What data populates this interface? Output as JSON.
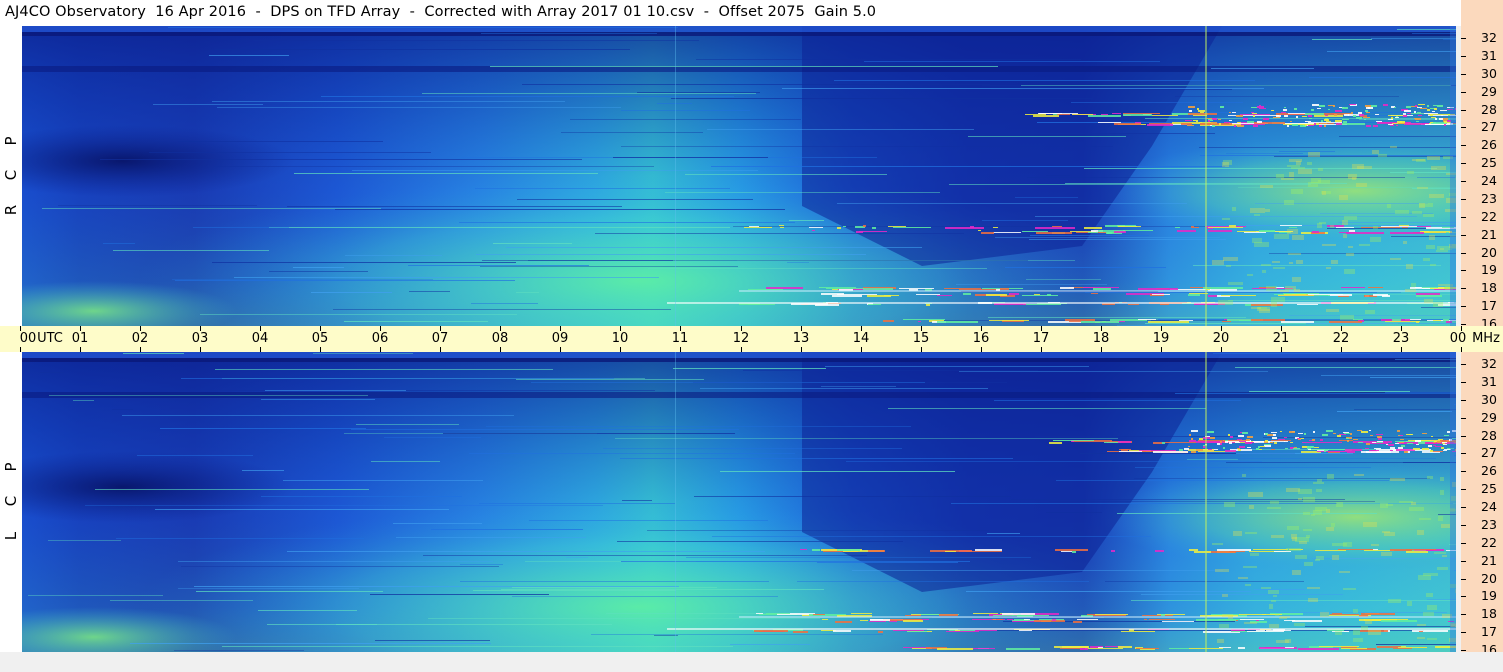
{
  "title": "AJ4CO Observatory  16 Apr 2016  -  DPS on TFD Array  -  Corrected with Array 2017 01 10.csv  -  Offset 2075  Gain 5.0",
  "colors": {
    "deep": "#0a1e8c",
    "blue": "#1e64e6",
    "cyan": "#28c8e6",
    "green": "#5af0b4",
    "yellow": "#e6e646",
    "magenta": "#e628c8",
    "axis_bg": "#fbd9bd",
    "time_bg": "#fefcc9"
  },
  "chart_data": [
    {
      "type": "heatmap",
      "polarization": "RCP",
      "side_letters": [
        "R",
        "C",
        "P"
      ],
      "x_unit": "UTC",
      "y_unit": "MHz",
      "ylim": [
        16,
        32
      ],
      "y_ticks": [
        "16",
        "17",
        "18",
        "19",
        "20",
        "21",
        "22",
        "23",
        "24",
        "25",
        "26",
        "27",
        "28",
        "29",
        "30",
        "31",
        "32"
      ]
    },
    {
      "type": "heatmap",
      "polarization": "LCP",
      "side_letters": [
        "L",
        "C",
        "P"
      ],
      "x_unit": "UTC",
      "y_unit": "MHz",
      "ylim": [
        16,
        32
      ],
      "y_ticks": [
        "16",
        "17",
        "18",
        "19",
        "20",
        "21",
        "22",
        "23",
        "24",
        "25",
        "26",
        "27",
        "28",
        "29",
        "30",
        "31",
        "32"
      ]
    }
  ],
  "time_axis": {
    "labels": [
      "00",
      "UTC",
      "01",
      "02",
      "03",
      "04",
      "05",
      "06",
      "07",
      "08",
      "09",
      "10",
      "11",
      "12",
      "13",
      "14",
      "15",
      "16",
      "17",
      "18",
      "19",
      "20",
      "21",
      "22",
      "23",
      "00",
      "MHz"
    ],
    "hours": [
      "00",
      "01",
      "02",
      "03",
      "04",
      "05",
      "06",
      "07",
      "08",
      "09",
      "10",
      "11",
      "12",
      "13",
      "14",
      "15",
      "16",
      "17",
      "18",
      "19",
      "20",
      "21",
      "22",
      "23",
      "00"
    ],
    "utc_label": "UTC",
    "mhz_label": "MHz"
  }
}
